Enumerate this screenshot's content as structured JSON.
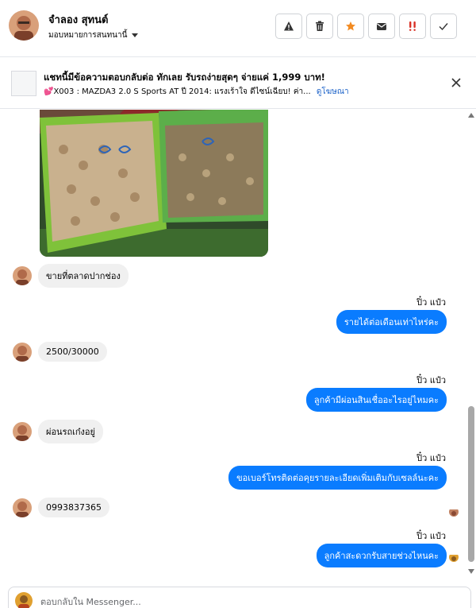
{
  "header": {
    "contact_name": "จำลอง สุทนต์",
    "assign_label": "มอบหมายการสนทนานี้",
    "actions": [
      {
        "name": "warning-icon",
        "color": "#333333"
      },
      {
        "name": "trash-icon",
        "color": "#333333"
      },
      {
        "name": "star-icon",
        "color": "#f28b22"
      },
      {
        "name": "envelope-icon",
        "color": "#333333"
      },
      {
        "name": "double-exclamation-icon",
        "color": "#d93025"
      },
      {
        "name": "checkmark-icon",
        "color": "#333333"
      }
    ]
  },
  "ad": {
    "title": "แชทนี้มีข้อความตอบกลับต่อ ทักเลย รับรถง่ายสุดๆ จ่ายแค่ 1,999 บาท!",
    "subtitle": "💕X003 : MAZDA3 2.0 S Sports AT ปี 2014: แรงเร้าใจ ดีไซน์เฉียบ! ค่า...",
    "link": "ดูโฆษณา"
  },
  "messages": {
    "in_1": "ขายที่ตลาดปากช่อง",
    "sender_1": "ปิ๋ว แป๋ว",
    "out_1": "รายได้ต่อเดือนเท่าไหร่คะ",
    "in_2": "2500/30000",
    "sender_2": "ปิ๋ว แป๋ว",
    "out_2": "ลูกค้ามีผ่อนสินเชื่ออะไรอยู่ไหมคะ",
    "in_3": "ผ่อนรถเก๋งอยู่",
    "sender_3": "ปิ๋ว แป๋ว",
    "out_3": "ขอเบอร์โทรติดต่อคุยรายละเอียดเพิ่มเติมกับเซลล์นะคะ",
    "in_4": "0993837365",
    "sender_4": "ปิ๋ว แป๋ว",
    "out_4": "ลูกค้าสะดวกรับสายช่วงไหนคะ"
  },
  "composer": {
    "placeholder": "ตอบกลับใน Messenger..."
  },
  "colors": {
    "outgoing_bubble": "#0a7cff",
    "incoming_bubble": "#f0f0f0",
    "link": "#1a61c8"
  }
}
